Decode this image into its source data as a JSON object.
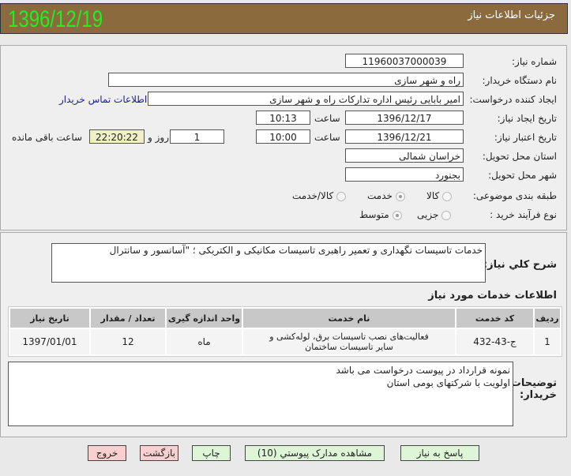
{
  "header": {
    "date": "1396/12/19",
    "title": "جزئیات اطلاعات نیاز"
  },
  "form": {
    "need_number_label": "شماره نیاز:",
    "need_number": "11960037000039",
    "buyer_label": "نام دستگاه خریدار:",
    "buyer": "راه  و شهر سازی",
    "creator_label": "ایجاد کننده درخواست:",
    "creator": "امیر بابایی رئیس اداره تدارکات راه  و شهر سازی",
    "contact_link": "اطلاعات تماس خریدار",
    "created_label": "تاریخ ایجاد نیاز:",
    "created_date": "1396/12/17",
    "time_label": "ساعت",
    "created_time": "10:13",
    "expiry_label": "تاریخ اعتبار نیاز:",
    "expiry_date": "1396/12/21",
    "expiry_time": "10:00",
    "days": "1",
    "days_label": "روز و",
    "countdown": "22:20:22",
    "remaining_label": "ساعت باقی مانده",
    "province_label": "استان محل تحویل:",
    "province": "خراسان شمالی",
    "city_label": "شهر محل تحویل:",
    "city": "بجنورد",
    "category_label": "طبقه بندی موضوعی:",
    "category_options": [
      "کالا",
      "خدمت",
      "کالا/خدمت"
    ],
    "category_selected": "خدمت",
    "process_label": "نوع فرآیند خرید :",
    "process_options": [
      "جزیی",
      "متوسط"
    ],
    "process_selected": "متوسط"
  },
  "description": {
    "label": "شرح کلي نياز:",
    "text": "خدمات تاسیسات نگهداری و تعمیر راهبری تاسیسات مکانیکی و الکتریکی ؛ \"آسانسور و سانترال"
  },
  "services": {
    "title": "اطلاعات خدمات مورد نیاز",
    "headers": [
      "ردیف",
      "کد خدمت",
      "نام خدمت",
      "واحد اندازه گیری",
      "تعداد / مقدار",
      "تاریخ نیاز"
    ],
    "rows": [
      [
        "1",
        "ج-43-432",
        "فعالیت‌های نصب تاسیسات برق، لوله‌کشی و سایر تاسیسات ساختمان",
        "ماه",
        "12",
        "1397/01/01"
      ]
    ]
  },
  "notes": {
    "label": "توضیحات خریدار:",
    "lines": [
      "نمونه قرارداد در پیوست درخواست می باشد",
      "اولویت با شرکتهای بومی استان"
    ]
  },
  "buttons": {
    "reply": "پاسخ به نیاز",
    "docs": "مشاهده مدارک پیوستي (10)",
    "print": "چاپ",
    "back": "بازگشت",
    "exit": "خروج"
  },
  "colors": {
    "header": "#8b6a3e",
    "date": "#22ee22",
    "link": "#1a1aaa",
    "countdown_bg": "#f0f0c8"
  }
}
